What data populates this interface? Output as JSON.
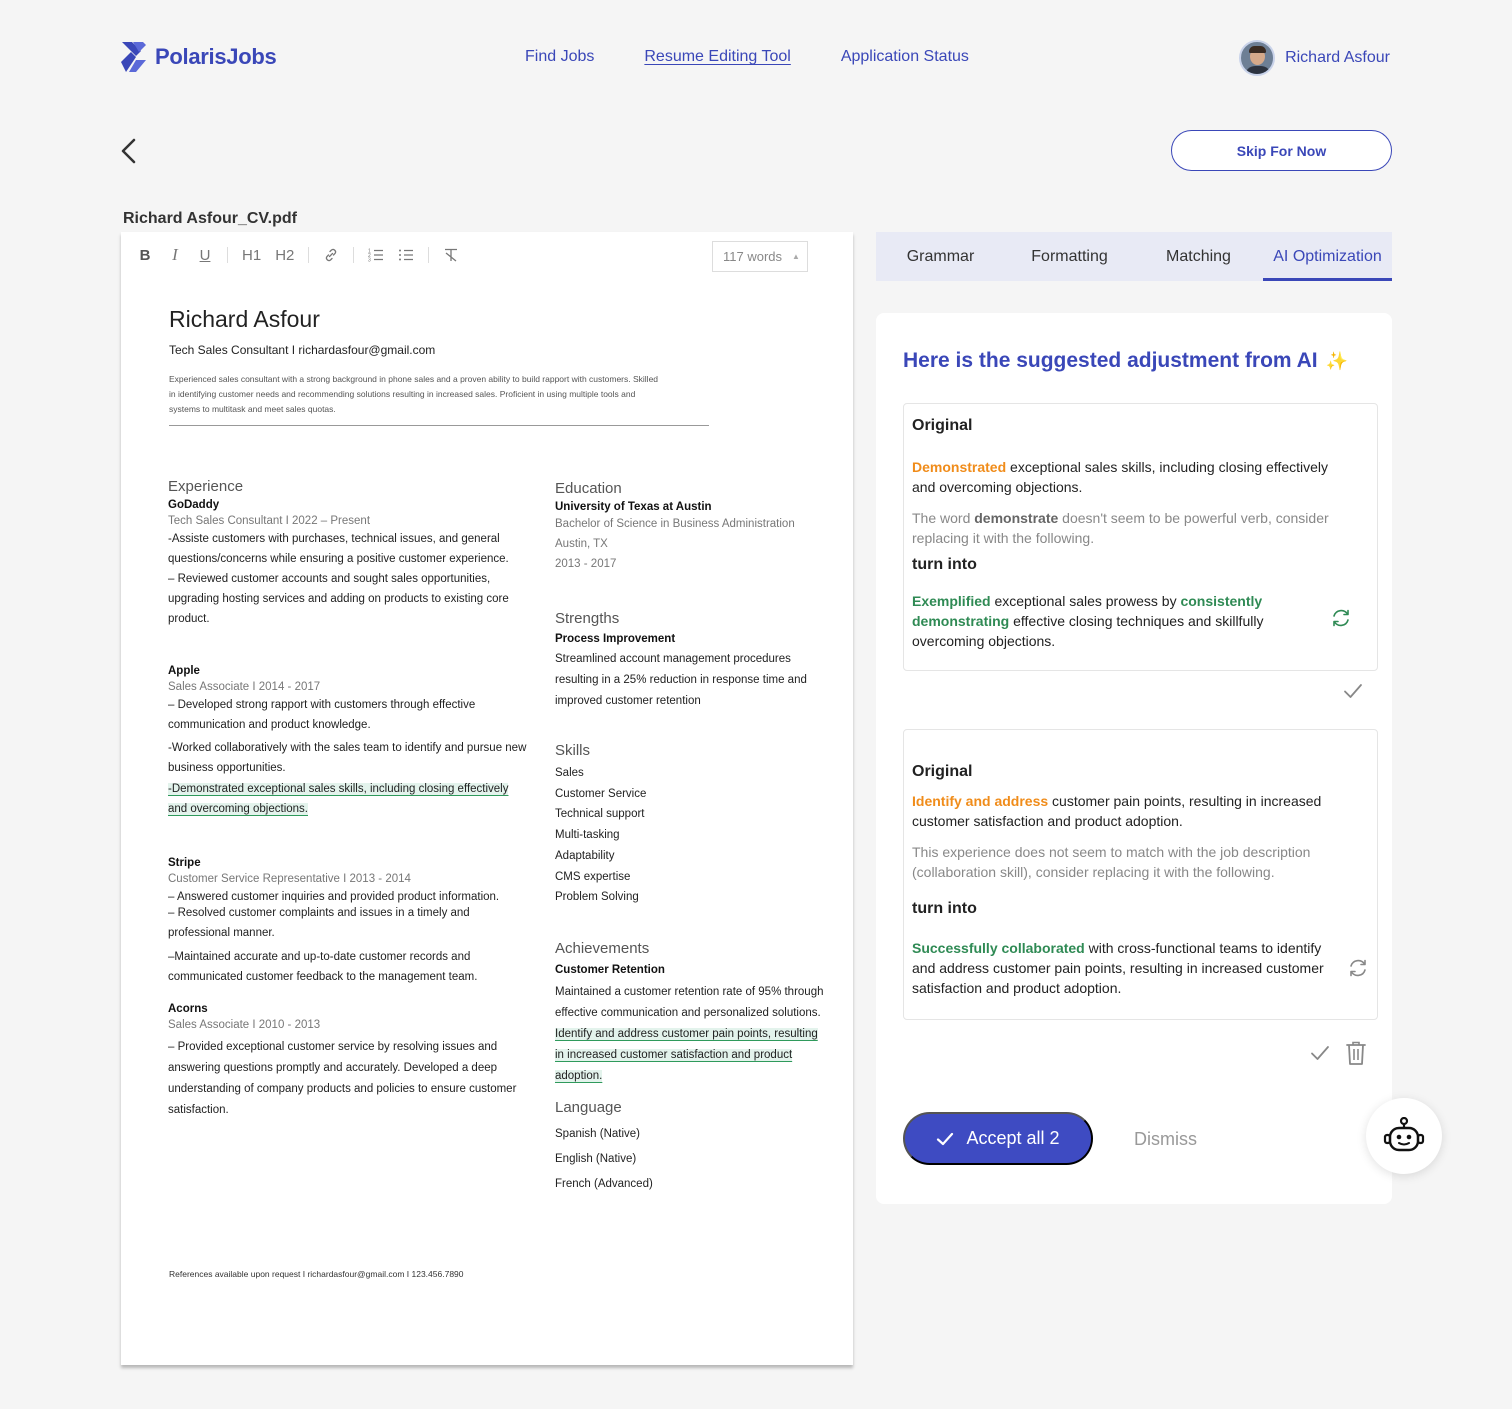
{
  "brand": {
    "name": "PolarisJobs",
    "color": "#3a47b8"
  },
  "nav": {
    "items": [
      "Find Jobs",
      "Resume Editing Tool",
      "Application Status"
    ],
    "active": "Resume Editing Tool"
  },
  "user": {
    "name": "Richard Asfour"
  },
  "actions": {
    "skip_label": "Skip For Now"
  },
  "file": {
    "name": "Richard Asfour_CV.pdf"
  },
  "editor": {
    "toolbar": {
      "bold": "B",
      "italic": "I",
      "underline": "U",
      "h1": "H1",
      "h2": "H2"
    },
    "word_count": "117 words"
  },
  "resume": {
    "name": "Richard Asfour",
    "subtitle": "Tech Sales Consultant  I  richardasfour@gmail.com",
    "summary": "Experienced sales consultant with a strong background in phone sales and a proven ability to build rapport with customers. Skilled in identifying customer needs and recommending solutions resulting in increased sales. Proficient in using multiple tools and systems to multitask and meet sales quotas.",
    "experience_heading": "Experience",
    "jobs": [
      {
        "company": "GoDaddy",
        "role": "Tech Sales Consultant I  2022 – Present",
        "bullets": [
          "-Assiste customers with purchases, technical issues, and general questions/concerns while ensuring a positive customer experience.",
          "– Reviewed customer accounts and sought sales opportunities, upgrading hosting services and adding on products to existing core product."
        ]
      },
      {
        "company": "Apple",
        "role": "Sales Associate  I  2014 - 2017",
        "bullets": [
          "– Developed strong rapport with customers through effective communication and product knowledge.",
          "-Worked collaboratively with the sales team to identify and pursue new business opportunities."
        ],
        "highlight": "-Demonstrated exceptional sales skills, including closing effectively and overcoming objections. "
      },
      {
        "company": "Stripe",
        "role": "Customer Service Representative  I  2013 - 2014",
        "bullets": [
          "– Answered customer inquiries and provided product information.",
          "– Resolved customer complaints and issues in a timely and professional manner.",
          "–Maintained accurate and up-to-date customer records and communicated customer feedback to the management team."
        ]
      },
      {
        "company": "Acorns",
        "role": "Sales Associate  I  2010 - 2013",
        "bullets": [
          "– Provided exceptional customer service by resolving issues and answering questions promptly and accurately. Developed a deep understanding of company products and policies to ensure customer satisfaction."
        ]
      }
    ],
    "education": {
      "heading": "Education",
      "school": "University of Texas at Austin",
      "degree": "Bachelor of Science in Business Administration",
      "location": "Austin, TX",
      "years": "2013 - 2017"
    },
    "strengths": {
      "heading": "Strengths",
      "title": "Process Improvement",
      "text": "Streamlined account management procedures resulting in a 25% reduction in response time and improved customer retention"
    },
    "skills": {
      "heading": "Skills",
      "items": [
        "Sales",
        "Customer Service",
        "Technical support",
        "Multi-tasking",
        "Adaptability",
        "CMS expertise",
        "Problem Solving"
      ]
    },
    "achievements": {
      "heading": "Achievements",
      "title": "Customer Retention",
      "text": "Maintained a customer retention rate of 95% through effective communication and personalized solutions.",
      "highlight": "Identify and address customer pain points, resulting in increased customer satisfaction and product adoption."
    },
    "language": {
      "heading": "Language",
      "items": [
        "Spanish (Native)",
        "English (Native)",
        "French (Advanced)"
      ]
    },
    "footer": "References available upon request   I   richardasfour@gmail.com   I   123.456.7890"
  },
  "tabs": [
    "Grammar",
    "Formatting",
    "Matching",
    "AI Optimization"
  ],
  "active_tab": "AI Optimization",
  "ai": {
    "title": "Here is the suggested adjustment from AI",
    "suggestions": [
      {
        "original_label": "Original",
        "original_flag": "Demonstrated",
        "original_rest": " exceptional sales skills, including closing effectively and overcoming objections.",
        "note_pre": "The word ",
        "note_word": "demonstrate",
        "note_post": " doesn't seem to be powerful verb, consider replacing it with the following.",
        "turn_label": "turn into",
        "new_a": "Exemplified",
        "new_b": " exceptional sales prowess by ",
        "new_c": "consistently demonstrating",
        "new_d": " effective closing techniques and skillfully overcoming objections."
      },
      {
        "original_label": "Original",
        "original_flag": "Identify and address",
        "original_rest": " customer pain points, resulting in increased customer satisfaction and product adoption.",
        "note": "This experience does not seem to match with the job description (collaboration skill), consider replacing it with the following.",
        "turn_label": "turn into",
        "new_a": "Successfully collaborated",
        "new_b": " with cross-functional teams to identify and address customer pain points, resulting in increased customer satisfaction and product adoption."
      }
    ],
    "accept_label": "Accept all 2",
    "dismiss_label": "Dismiss"
  },
  "colors": {
    "accent": "#3a47b8",
    "flag": "#f08c1a",
    "suggest": "#2f8a54",
    "highlight_bg": "#e3f3ec"
  }
}
